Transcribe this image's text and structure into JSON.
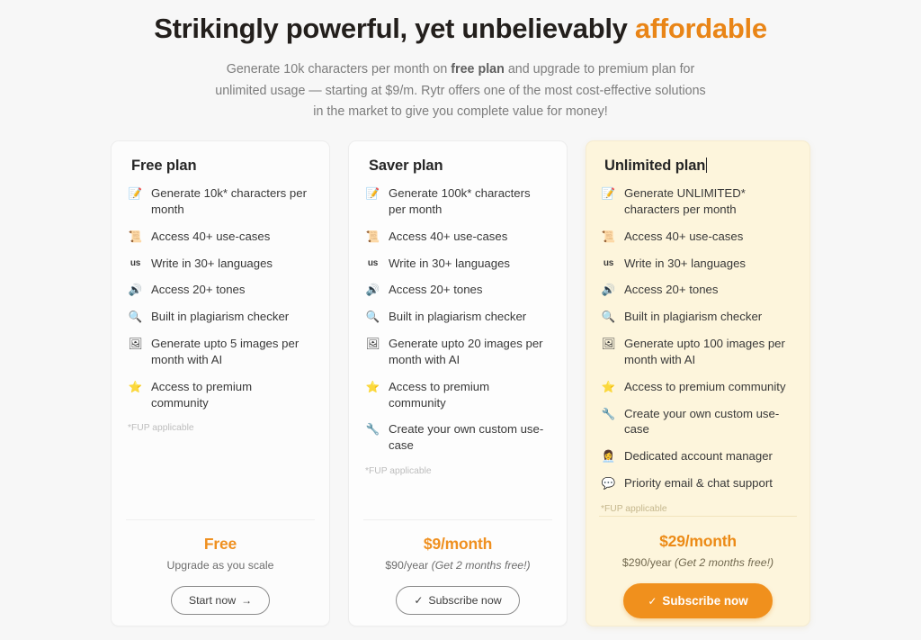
{
  "header": {
    "title_plain": "Strikingly powerful, yet unbelievably ",
    "title_accent": "affordable",
    "subtitle_line1_a": "Generate 10k characters per month on ",
    "subtitle_line1_b": "free plan",
    "subtitle_line1_c": " and upgrade to premium plan for",
    "subtitle_line2": "unlimited usage — starting at $9/m. Rytr offers one of the most cost-effective",
    "subtitle_line3": "solutions in the market to give you complete value for money!"
  },
  "colors": {
    "accent_orange": "#e98517",
    "price_orange": "#ef9020",
    "highlight_bg": "#fdf5dc",
    "highlight_border": "#f6ecd0",
    "card_bg": "#fcfcfc",
    "page_bg": "#f7f7f7",
    "muted_text": "#7d7d7d",
    "body_text": "#393939"
  },
  "plans": [
    {
      "id": "free",
      "title": "Free plan",
      "has_caret": false,
      "highlighted": false,
      "features": [
        {
          "icon": "memo-icon",
          "glyph": "📝",
          "text": "Generate 10k* characters per month"
        },
        {
          "icon": "scroll-icon",
          "glyph": "📜",
          "text": "Access 40+ use-cases"
        },
        {
          "icon": "us-flag-icon",
          "glyph": "us",
          "text": "Write in 30+ languages"
        },
        {
          "icon": "speaker-icon",
          "glyph": "🔊",
          "text": "Access 20+ tones"
        },
        {
          "icon": "magnifier-icon",
          "glyph": "🔍",
          "text": "Built in plagiarism checker"
        },
        {
          "icon": "framed-picture-icon",
          "glyph": "🖼",
          "text": "Generate upto 5 images per month with AI"
        },
        {
          "icon": "star-icon",
          "glyph": "⭐",
          "text": "Access to premium community"
        }
      ],
      "footnote": "*FUP applicable",
      "price": "Free",
      "price_sub_plain": "Upgrade as you scale",
      "price_sub_italic": "",
      "cta_label": "Start now",
      "cta_icon": "arrow-right-icon",
      "cta_glyph": "→",
      "cta_style": "outline"
    },
    {
      "id": "saver",
      "title": "Saver plan",
      "has_caret": false,
      "highlighted": false,
      "features": [
        {
          "icon": "memo-icon",
          "glyph": "📝",
          "text": "Generate 100k* characters per month"
        },
        {
          "icon": "scroll-icon",
          "glyph": "📜",
          "text": "Access 40+ use-cases"
        },
        {
          "icon": "us-flag-icon",
          "glyph": "us",
          "text": "Write in 30+ languages"
        },
        {
          "icon": "speaker-icon",
          "glyph": "🔊",
          "text": "Access 20+ tones"
        },
        {
          "icon": "magnifier-icon",
          "glyph": "🔍",
          "text": "Built in plagiarism checker"
        },
        {
          "icon": "framed-picture-icon",
          "glyph": "🖼",
          "text": "Generate upto 20 images per month with AI"
        },
        {
          "icon": "star-icon",
          "glyph": "⭐",
          "text": "Access to premium community"
        },
        {
          "icon": "wrench-icon",
          "glyph": "🔧",
          "text": "Create your own custom use-case"
        }
      ],
      "footnote": "*FUP applicable",
      "price": "$9/month",
      "price_sub_plain": "$90/year ",
      "price_sub_italic": "(Get 2 months free!)",
      "cta_label": "Subscribe now",
      "cta_icon": "check-icon",
      "cta_glyph": "✓",
      "cta_style": "outline"
    },
    {
      "id": "unlimited",
      "title": "Unlimited plan",
      "has_caret": true,
      "highlighted": true,
      "features": [
        {
          "icon": "memo-icon",
          "glyph": "📝",
          "text": "Generate UNLIMITED* characters per month"
        },
        {
          "icon": "scroll-icon",
          "glyph": "📜",
          "text": "Access 40+ use-cases"
        },
        {
          "icon": "us-flag-icon",
          "glyph": "us",
          "text": "Write in 30+ languages"
        },
        {
          "icon": "speaker-icon",
          "glyph": "🔊",
          "text": "Access 20+ tones"
        },
        {
          "icon": "magnifier-icon",
          "glyph": "🔍",
          "text": "Built in plagiarism checker"
        },
        {
          "icon": "framed-picture-icon",
          "glyph": "🖼",
          "text": "Generate upto 100 images per month with AI"
        },
        {
          "icon": "star-icon",
          "glyph": "⭐",
          "text": "Access to premium community"
        },
        {
          "icon": "wrench-icon",
          "glyph": "🔧",
          "text": "Create your own custom use-case"
        },
        {
          "icon": "account-manager-icon",
          "glyph": "👩‍💼",
          "text": "Dedicated account manager"
        },
        {
          "icon": "chat-bubble-icon",
          "glyph": "💬",
          "text": "Priority email & chat support"
        }
      ],
      "footnote": "*FUP applicable",
      "price": "$29/month",
      "price_sub_plain": "$290/year ",
      "price_sub_italic": "(Get 2 months free!)",
      "cta_label": "Subscribe now",
      "cta_icon": "check-icon",
      "cta_glyph": "✓",
      "cta_style": "solid"
    }
  ]
}
